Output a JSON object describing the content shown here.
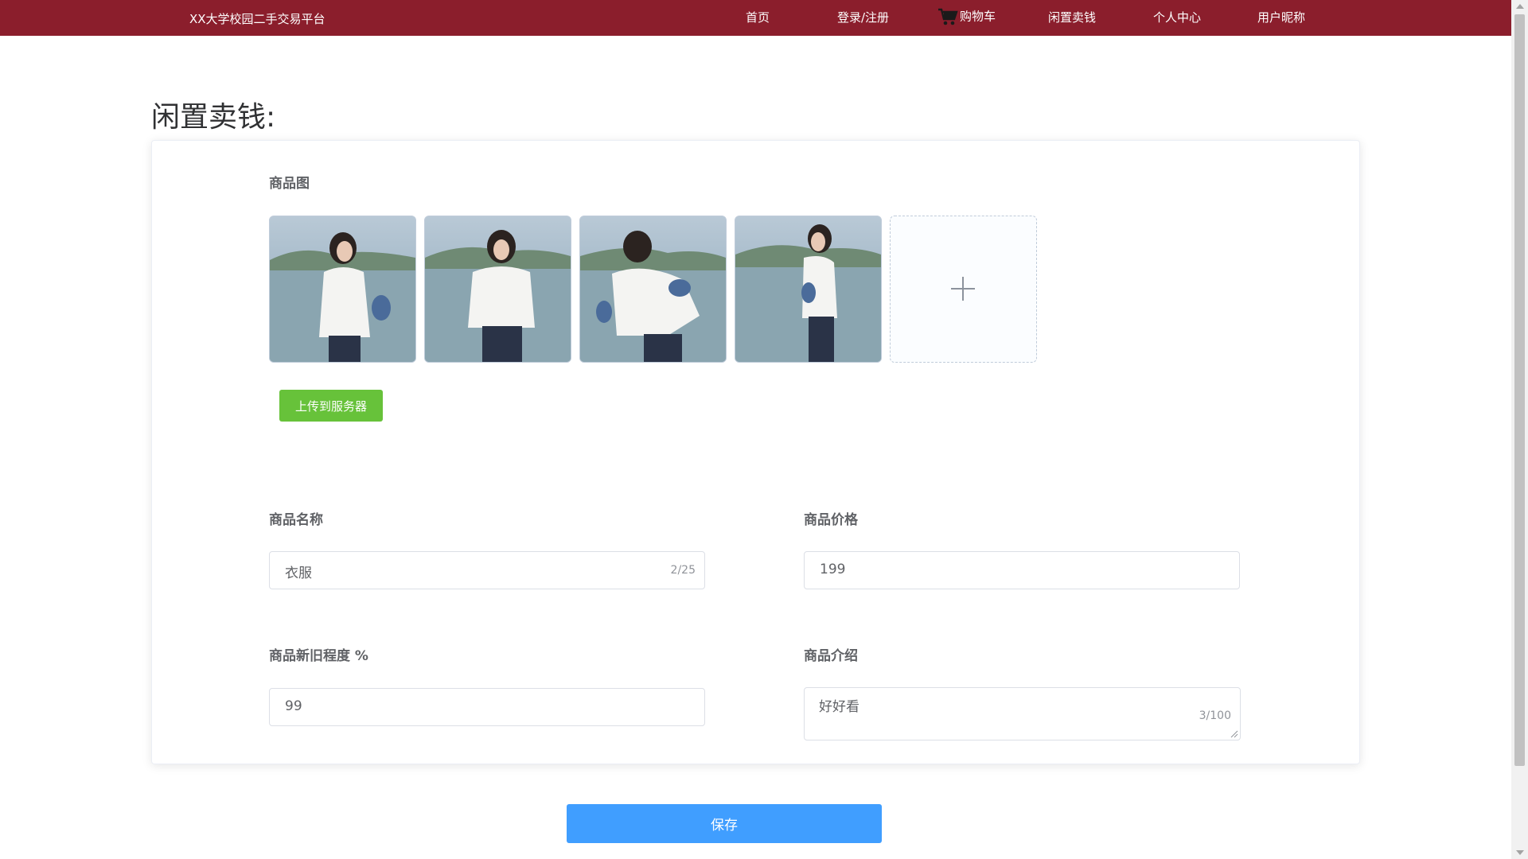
{
  "header": {
    "brand": "XX大学校园二手交易平台",
    "nav": {
      "home": "首页",
      "login": "登录/注册",
      "cart": "购物车",
      "sell": "闲置卖钱",
      "profile": "个人中心",
      "username": "用户昵称"
    },
    "cart_icon": "cart-icon"
  },
  "page": {
    "title": "闲置卖钱:"
  },
  "form": {
    "images_label": "商品图",
    "add_icon": "plus-icon",
    "upload_button": "上传到服务器",
    "name_label": "商品名称",
    "name_value": "衣服",
    "name_counter": "2/25",
    "price_label": "商品价格",
    "price_value": "199",
    "condition_label": "商品新旧程度 %",
    "condition_value": "99",
    "desc_label": "商品介绍",
    "desc_value": "好好看",
    "desc_counter": "3/100"
  },
  "actions": {
    "save": "保存"
  },
  "colors": {
    "header_bg": "#8b1e2c",
    "upload_green": "#67c23a",
    "save_blue": "#409eff"
  }
}
